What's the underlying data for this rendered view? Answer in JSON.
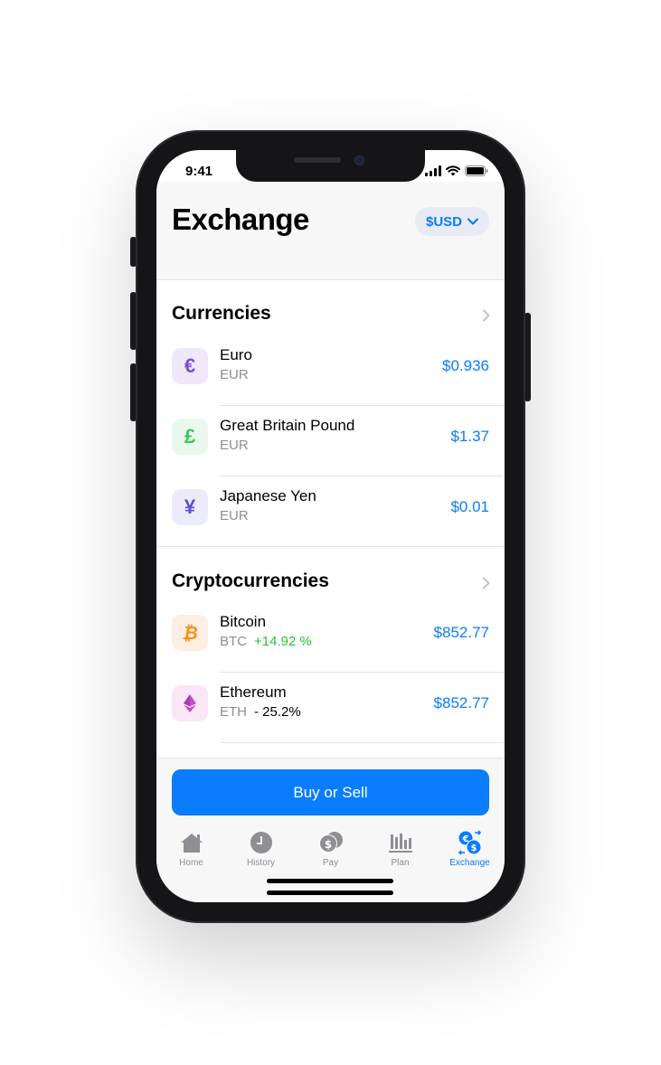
{
  "status": {
    "time": "9:41"
  },
  "header": {
    "title": "Exchange",
    "currency_selector": "$USD"
  },
  "sections": {
    "currencies": {
      "title": "Currencies",
      "items": [
        {
          "symbol": "€",
          "name": "Euro",
          "code": "EUR",
          "price": "$0.936",
          "icon": "euro-icon",
          "color": "#7a4fd6",
          "bg": "#efe8fb"
        },
        {
          "symbol": "£",
          "name": "Great Britain Pound",
          "code": "EUR",
          "price": "$1.37",
          "icon": "pound-icon",
          "color": "#3fc25a",
          "bg": "#e9f8ec"
        },
        {
          "symbol": "¥",
          "name": "Japanese Yen",
          "code": "EUR",
          "price": "$0.01",
          "icon": "yen-icon",
          "color": "#5a4fd6",
          "bg": "#ecebfb"
        }
      ]
    },
    "crypto": {
      "title": "Cryptocurrencies",
      "items": [
        {
          "name": "Bitcoin",
          "code": "BTC",
          "change": "+14.92 %",
          "change_color": "#25c23a",
          "price": "$852.77",
          "icon": "bitcoin-icon",
          "bg": "#fdeee2"
        },
        {
          "name": "Ethereum",
          "code": "ETH",
          "change": "- 25.2%",
          "change_color": "#000000",
          "price": "$852.77",
          "icon": "ethereum-icon",
          "bg": "#f9e6f6"
        }
      ]
    }
  },
  "cta": {
    "label": "Buy or Sell"
  },
  "tabs": [
    {
      "label": "Home",
      "icon": "home-icon"
    },
    {
      "label": "History",
      "icon": "clock-icon"
    },
    {
      "label": "Pay",
      "icon": "coins-icon"
    },
    {
      "label": "Plan",
      "icon": "bar-chart-icon"
    },
    {
      "label": "Exchange",
      "icon": "exchange-icon",
      "active": true
    }
  ],
  "colors": {
    "accent": "#0a7cff",
    "positive": "#25c23a"
  }
}
